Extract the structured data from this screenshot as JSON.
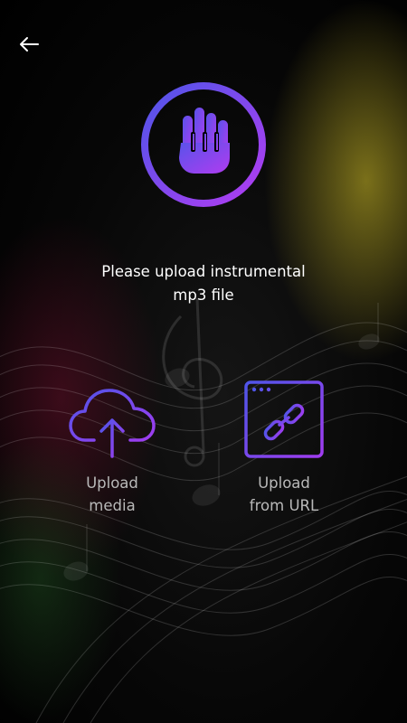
{
  "screen": {
    "prompt_line1": "Please upload instrumental",
    "prompt_line2": "mp3 file"
  },
  "icons": {
    "back": "arrow-left-icon",
    "logo": "hand-piano-logo-icon",
    "upload_media": "cloud-upload-icon",
    "upload_url": "browser-link-icon"
  },
  "options": {
    "media": {
      "line1": "Upload",
      "line2": "media"
    },
    "url": {
      "line1": "Upload",
      "line2": "from URL"
    }
  },
  "colors": {
    "accent_start": "#4f55e8",
    "accent_end": "#b23cf2",
    "text_primary": "#ffffff",
    "text_secondary": "#b9b9b9",
    "background": "#000000"
  }
}
